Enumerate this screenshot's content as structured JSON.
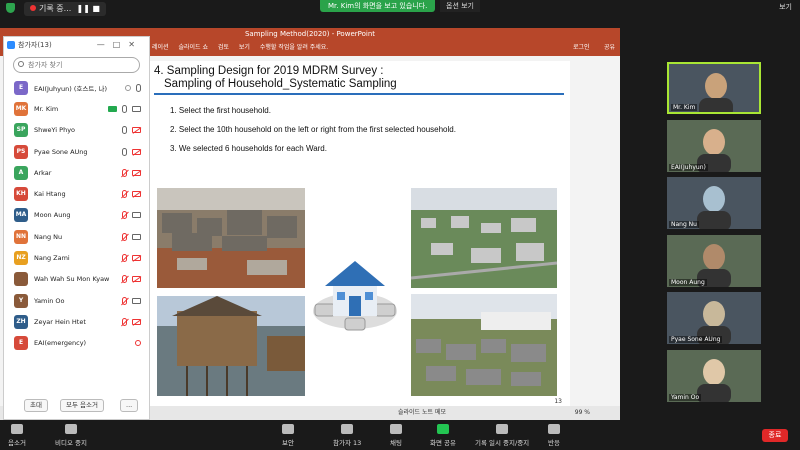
{
  "topbar": {
    "recording_label": "기록 중...",
    "share_banner": "Mr. Kim의 화면을 보고 있습니다.",
    "view_options": "옵션 보기",
    "view_right": "보기"
  },
  "powerpoint": {
    "window_title": "Sampling Method(2020) - PowerPoint",
    "ribbon": [
      "레이션",
      "슬라이드 쇼",
      "검토",
      "보기",
      "수행할 작업을 알려 주세요."
    ],
    "login": "로그인",
    "share": "공유",
    "status_notes": "슬라이드 노트",
    "status_comments": "메모",
    "zoom": "99 %",
    "slide": {
      "title_line1": "4. Sampling Design for 2019 MDRM Survey :",
      "title_line2": "Sampling of Household_Systematic Sampling",
      "items": [
        "1. Select the first household.",
        "2. Select the 10th household on the left or right from the first selected household.",
        "3. We selected 6 households for each Ward."
      ],
      "page_number": "13"
    }
  },
  "participants": {
    "title": "참가자(13)",
    "search_placeholder": "참가자 찾기",
    "list": [
      {
        "initials": "E",
        "name": "EAI(Juhyun) (호스트, 나)",
        "color": "#7b68c8",
        "mic": "on",
        "cam": "none",
        "extra": "host"
      },
      {
        "initials": "MK",
        "name": "Mr. Kim",
        "color": "#e0733a",
        "mic": "on",
        "cam": "on",
        "extra": "share"
      },
      {
        "initials": "SP",
        "name": "ShweYi Phyo",
        "color": "#3aa55d",
        "mic": "on",
        "cam": "off",
        "extra": ""
      },
      {
        "initials": "PS",
        "name": "Pyae Sone AUng",
        "color": "#d64a3a",
        "mic": "on",
        "cam": "off",
        "extra": ""
      },
      {
        "initials": "A",
        "name": "Arkar",
        "color": "#3aa55d",
        "mic": "off",
        "cam": "off",
        "extra": ""
      },
      {
        "initials": "KH",
        "name": "Kai Htang",
        "color": "#d64a3a",
        "mic": "off",
        "cam": "off",
        "extra": ""
      },
      {
        "initials": "MA",
        "name": "Moon Aung",
        "color": "#2f5d8a",
        "mic": "off",
        "cam": "on",
        "extra": ""
      },
      {
        "initials": "NN",
        "name": "Nang Nu",
        "color": "#e0733a",
        "mic": "off",
        "cam": "on",
        "extra": ""
      },
      {
        "initials": "NZ",
        "name": "Nang Zami",
        "color": "#e8a020",
        "mic": "off",
        "cam": "off",
        "extra": ""
      },
      {
        "initials": "",
        "name": "Wah Wah Su Mon Kyaw",
        "color": "#8a5a3a",
        "mic": "off",
        "cam": "off",
        "extra": ""
      },
      {
        "initials": "Y",
        "name": "Yamin Oo",
        "color": "#8a5a3a",
        "mic": "off",
        "cam": "on",
        "extra": ""
      },
      {
        "initials": "ZH",
        "name": "Zeyar Hein Htet",
        "color": "#2f5d8a",
        "mic": "off",
        "cam": "off",
        "extra": ""
      },
      {
        "initials": "E",
        "name": "EAI(emergency)",
        "color": "#d64a3a",
        "mic": "none",
        "cam": "none",
        "extra": "rec"
      }
    ],
    "invite": "초대",
    "mute_all": "모두 음소거",
    "more": "..."
  },
  "videos": [
    {
      "name": "Mr. Kim",
      "active": true
    },
    {
      "name": "EAI(Juhyun)",
      "active": false
    },
    {
      "name": "Nang Nu",
      "active": false
    },
    {
      "name": "Moon Aung",
      "active": false
    },
    {
      "name": "Pyae Sone AUng",
      "active": false
    },
    {
      "name": "Yamin Oo",
      "active": false
    }
  ],
  "toolbar": {
    "mute": "음소거",
    "video_stop": "비디오 중지",
    "security": "보안",
    "participants": "참가자",
    "participants_count": "13",
    "chat": "채팅",
    "share_screen": "화면 공유",
    "record_pause": "기록 일시 중지/중지",
    "reactions": "반응",
    "end": "종료"
  },
  "colors": {
    "powerpoint_red": "#b7472a",
    "zoom_green": "#23c552",
    "active_speaker": "#a9e634",
    "end_red": "#e02828"
  }
}
